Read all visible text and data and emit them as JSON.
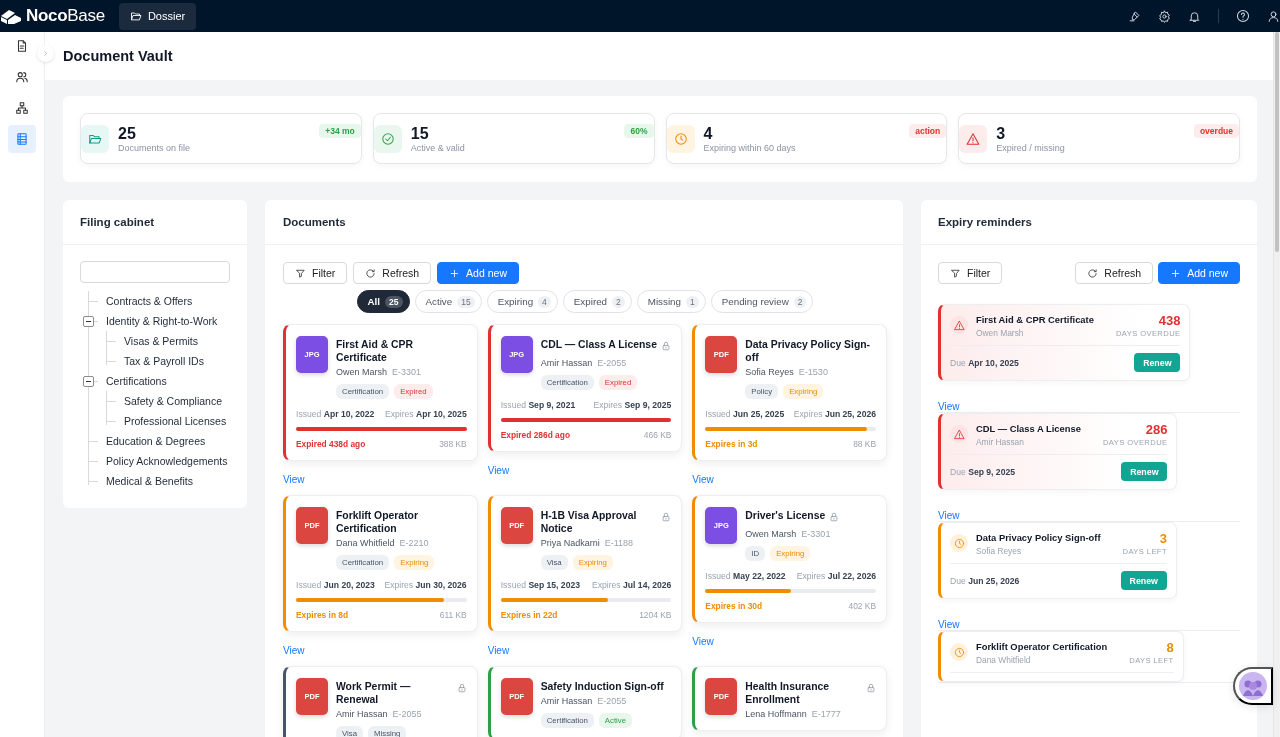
{
  "app": {
    "logo": "**Noco**Base",
    "tabs": [
      {
        "label": "Dossier",
        "selected": true
      }
    ]
  },
  "rail": [
    {
      "kind": "document",
      "selected": false
    },
    {
      "kind": "users",
      "selected": false
    },
    {
      "kind": "org",
      "selected": false
    },
    {
      "kind": "table",
      "selected": true
    }
  ],
  "page_title": "Document Vault",
  "stats": [
    {
      "kind": "folder",
      "value": "25",
      "label": "Documents on file",
      "badge": "+34 mo"
    },
    {
      "kind": "check",
      "value": "15",
      "label": "Active & valid",
      "badge": "60%"
    },
    {
      "kind": "clock",
      "value": "4",
      "label": "Expiring within 60 days",
      "badge": "action"
    },
    {
      "kind": "warning",
      "value": "3",
      "label": "Expired / missing",
      "badge": "overdue"
    }
  ],
  "filing_cabinet": {
    "title": "Filing cabinet",
    "tree": [
      {
        "label": "Contracts & Offers"
      },
      {
        "label": "Identity & Right-to-Work",
        "expanded": true,
        "children": [
          {
            "label": "Visas & Permits"
          },
          {
            "label": "Tax & Payroll IDs"
          }
        ]
      },
      {
        "label": "Certifications",
        "expanded": true,
        "children": [
          {
            "label": "Safety & Compliance"
          },
          {
            "label": "Professional Licenses"
          }
        ]
      },
      {
        "label": "Education & Degrees"
      },
      {
        "label": "Policy Acknowledgements"
      },
      {
        "label": "Medical & Benefits"
      }
    ]
  },
  "documents": {
    "title": "Documents",
    "buttons": [
      {
        "kind": "filter",
        "label": "Filter"
      },
      {
        "kind": "refresh",
        "label": "Refresh"
      },
      {
        "kind": "add",
        "label": "Add new"
      }
    ],
    "chips": [
      {
        "label": "All",
        "count": "25",
        "selected": true
      },
      {
        "label": "Active",
        "count": "15",
        "selected": false
      },
      {
        "label": "Expiring",
        "count": "4",
        "selected": false
      },
      {
        "label": "Expired",
        "count": "2",
        "selected": false
      },
      {
        "label": "Missing",
        "count": "1",
        "selected": false
      },
      {
        "label": "Pending review",
        "count": "2",
        "selected": false
      }
    ],
    "cards": [
      {
        "kind": "expired",
        "color": "#7c4ee4",
        "type": "JPG",
        "title": "First Aid & CPR Certificate",
        "locked": false,
        "owner": "Owen Marsh",
        "emp_id": "E-3301",
        "category": "Certification",
        "status": "Expired",
        "issued": "Issued **Apr 10, 2022**",
        "expires": "Expires **Apr 10, 2025**",
        "level": 1,
        "note": "Expired 438d ago",
        "size": "388 KB",
        "link": "View"
      },
      {
        "kind": "expired",
        "color": "#7c4ee4",
        "type": "JPG",
        "title": "CDL — Class A License",
        "locked": true,
        "owner": "Amir Hassan",
        "emp_id": "E-2055",
        "category": "Certification",
        "status": "Expired",
        "issued": "Issued **Sep 9, 2021**",
        "expires": "Expires **Sep 9, 2025**",
        "level": 1,
        "note": "Expired 286d ago",
        "size": "466 KB",
        "link": "View"
      },
      {
        "kind": "expiring",
        "color": "#dc4640",
        "type": "PDF",
        "title": "Data Privacy Policy Sign-off",
        "locked": false,
        "owner": "Sofia Reyes",
        "emp_id": "E-1530",
        "category": "Policy",
        "status": "Expiring",
        "issued": "Issued **Jun 25, 2025**",
        "expires": "Expires **Jun 25, 2026**",
        "level": 0.95,
        "note": "Expires in 3d",
        "size": "88 KB",
        "link": "View"
      },
      {
        "kind": "expiring",
        "color": "#dc4640",
        "type": "PDF",
        "title": "Forklift Operator Certification",
        "locked": false,
        "owner": "Dana Whitfield",
        "emp_id": "E-2210",
        "category": "Certification",
        "status": "Expiring",
        "issued": "Issued **Jun 20, 2023**",
        "expires": "Expires **Jun 30, 2026**",
        "level": 0.87,
        "note": "Expires in 8d",
        "size": "611 KB",
        "link": "View"
      },
      {
        "kind": "expiring",
        "color": "#dc4640",
        "type": "PDF",
        "title": "H-1B Visa Approval Notice",
        "locked": true,
        "owner": "Priya Nadkarni",
        "emp_id": "E-1188",
        "category": "Visa",
        "status": "Expiring",
        "issued": "Issued **Sep 15, 2023**",
        "expires": "Expires **Jul 14, 2026**",
        "level": 0.63,
        "note": "Expires in 22d",
        "size": "1204 KB",
        "link": "View"
      },
      {
        "kind": "expiring",
        "color": "#7c4ee4",
        "type": "JPG",
        "title": "Driver's License",
        "locked": true,
        "owner": "Owen Marsh",
        "emp_id": "E-3301",
        "category": "ID",
        "status": "Expiring",
        "issued": "Issued **May 22, 2022**",
        "expires": "Expires **Jul 22, 2026**",
        "level": 0.5,
        "note": "Expires in 30d",
        "size": "402 KB",
        "link": "View"
      },
      {
        "kind": "missing",
        "color": "#dc4640",
        "type": "PDF",
        "title": "Work Permit — Renewal",
        "locked": true,
        "owner": "Amir Hassan",
        "emp_id": "E-2055",
        "category": "Visa",
        "status": "Missing"
      },
      {
        "kind": "active",
        "color": "#dc4640",
        "type": "PDF",
        "title": "Safety Induction Sign-off",
        "locked": false,
        "owner": "Amir Hassan",
        "emp_id": "E-2055",
        "category": "Certification",
        "status": "Active"
      },
      {
        "kind": "active",
        "color": "#dc4640",
        "type": "PDF",
        "title": "Health Insurance Enrollment",
        "locked": true,
        "owner": "Lena Hoffmann",
        "emp_id": "E-1777"
      }
    ]
  },
  "reminders": {
    "title": "Expiry reminders",
    "buttons": [
      {
        "kind": "filter",
        "label": "Filter"
      },
      {
        "kind": "refresh",
        "label": "Refresh"
      },
      {
        "kind": "add",
        "label": "Add new"
      }
    ],
    "items": [
      {
        "kind": "overdue",
        "title": "First Aid & CPR Certificate",
        "owner": "Owen Marsh",
        "count": "438",
        "unit": "DAYS OVERDUE",
        "due": "Due **Apr 10, 2025**",
        "action": "Renew",
        "link": "View"
      },
      {
        "kind": "overdue",
        "title": "CDL — Class A License",
        "owner": "Amir Hassan",
        "count": "286",
        "unit": "DAYS OVERDUE",
        "due": "Due **Sep 9, 2025**",
        "action": "Renew",
        "link": "View"
      },
      {
        "kind": "left",
        "title": "Data Privacy Policy Sign-off",
        "owner": "Sofia Reyes",
        "count": "3",
        "unit": "DAYS LEFT",
        "due": "Due **Jun 25, 2026**",
        "action": "Renew",
        "link": "View"
      },
      {
        "kind": "left",
        "title": "Forklift Operator Certification",
        "owner": "Dana Whitfield",
        "count": "8",
        "unit": "DAYS LEFT"
      }
    ]
  }
}
